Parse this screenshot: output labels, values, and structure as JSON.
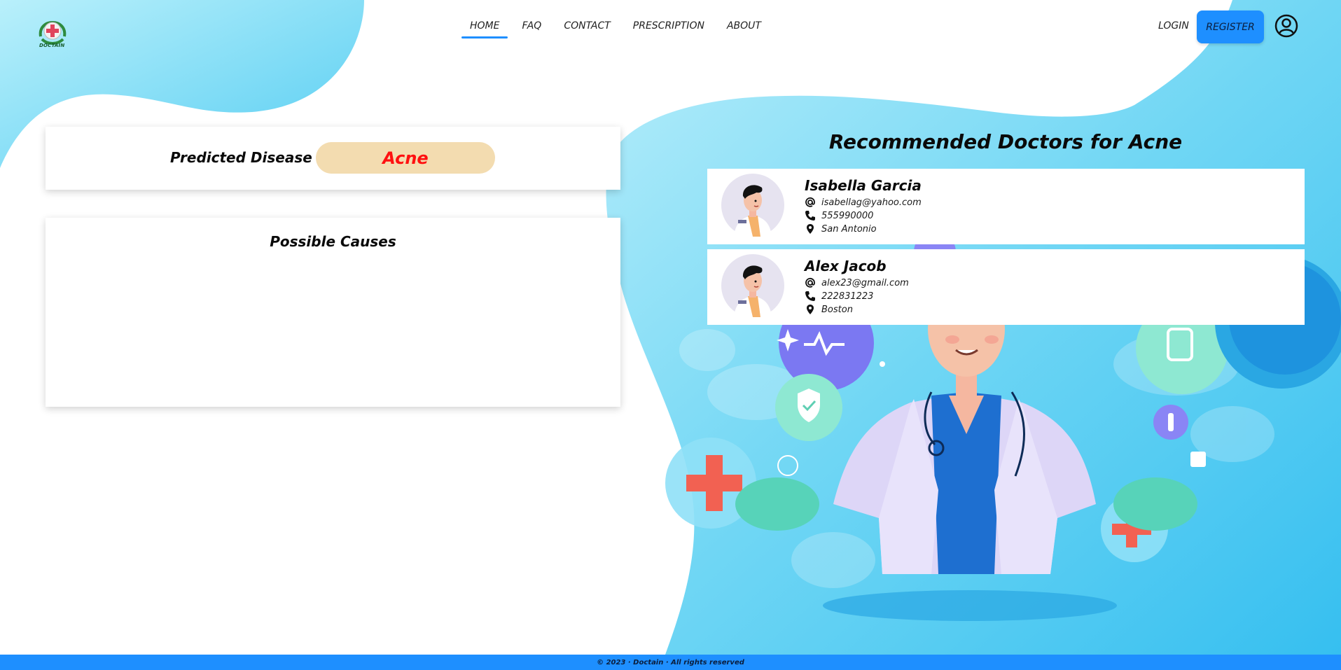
{
  "brand": {
    "logo_text": "DOCTAIN",
    "logo_icon": "medical-cross-logo"
  },
  "nav": {
    "items": [
      {
        "label": "HOME",
        "active": true
      },
      {
        "label": "FAQ",
        "active": false
      },
      {
        "label": "CONTACT",
        "active": false
      },
      {
        "label": "PRESCRIPTION",
        "active": false
      },
      {
        "label": "ABOUT",
        "active": false
      }
    ],
    "login_label": "LOGIN",
    "register_label": "REGISTER",
    "user_icon": "user-circle-icon"
  },
  "prediction": {
    "label": "Predicted Disease :",
    "disease": "Acne"
  },
  "causes": {
    "title": "Possible Causes"
  },
  "doctors": {
    "title": "Recommended Doctors for Acne",
    "list": [
      {
        "name": "Isabella Garcia",
        "email": "isabellag@yahoo.com",
        "phone": "555990000",
        "location": "San Antonio"
      },
      {
        "name": "Alex Jacob",
        "email": "alex23@gmail.com",
        "phone": "222831223",
        "location": "Boston"
      }
    ]
  },
  "footer": {
    "text": "© 2023 · Doctain · All rights reserved"
  },
  "colors": {
    "accent": "#1e8fff",
    "disease_text": "#ff1010",
    "disease_pill": "#f3dcb0",
    "bg_blue": "#5ed3f3"
  }
}
